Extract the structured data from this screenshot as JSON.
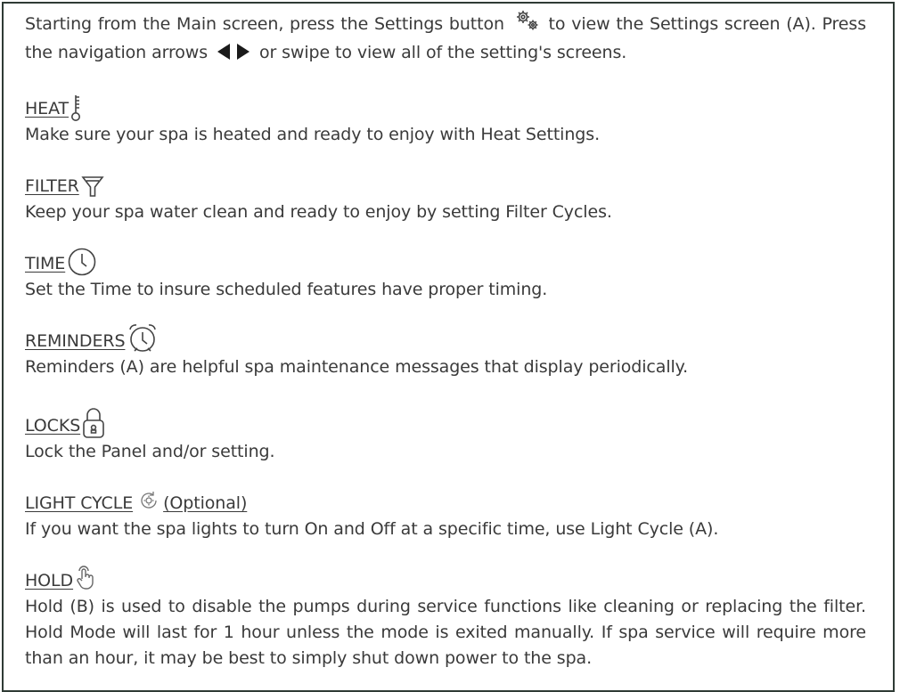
{
  "intro": {
    "part1": "Starting from the Main screen, press the Settings button",
    "part2": "to view the Settings screen (A). Press the navigation arrows",
    "part3": "or swipe to view all of the setting's screens."
  },
  "icons": {
    "settings": "gear-icon",
    "nav": "navigation-arrows-icon",
    "heat": "thermometer-icon",
    "filter": "funnel-icon",
    "time": "clock-icon",
    "reminders": "alarm-clock-icon",
    "locks": "padlock-icon",
    "light": "light-cycle-icon",
    "hold": "hand-icon"
  },
  "sections": [
    {
      "title": "HEAT",
      "desc": "Make sure your spa is heated and ready to enjoy with Heat Settings."
    },
    {
      "title": "FILTER",
      "desc": "Keep your spa water clean and ready to enjoy by setting Filter Cycles."
    },
    {
      "title": "TIME",
      "desc": "Set the Time to insure scheduled features have proper timing."
    },
    {
      "title": "REMINDERS",
      "desc": "Reminders (A) are helpful spa maintenance messages that display periodically."
    },
    {
      "title": "LOCKS",
      "desc": "Lock the Panel and/or setting."
    },
    {
      "title": "LIGHT CYCLE",
      "title_suffix": "(Optional)",
      "desc": "If you want the spa lights to turn On and Off at a specific time, use Light Cycle (A)."
    },
    {
      "title": "HOLD",
      "desc": "Hold (B) is used to disable the pumps during service functions like cleaning or replacing the filter. Hold Mode will last for 1 hour unless the mode is exited manually. If spa service will require more than an hour, it may be best to simply shut down power to the spa."
    }
  ]
}
